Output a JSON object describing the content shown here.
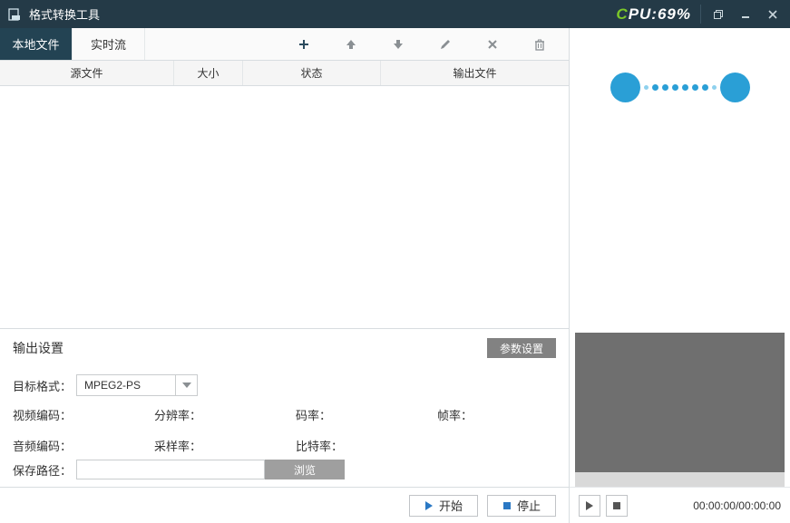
{
  "titlebar": {
    "title": "格式转换工具",
    "cpu_prefix": "C",
    "cpu_rest": "PU:69%"
  },
  "tabs": {
    "local": "本地文件",
    "stream": "实时流"
  },
  "toolbar_icons": {
    "add": "plus-icon",
    "up": "arrow-up-icon",
    "down": "arrow-down-icon",
    "edit": "pencil-icon",
    "remove": "x-icon",
    "clear": "trash-icon"
  },
  "columns": {
    "source": "源文件",
    "size": "大小",
    "state": "状态",
    "output": "输出文件"
  },
  "output": {
    "panel_title": "输出设置",
    "param_btn": "参数设置",
    "target_label": "目标格式：",
    "target_value": "MPEG2-PS",
    "video_codec": "视频编码：",
    "resolution": "分辨率：",
    "bitrate": "码率：",
    "framerate": "帧率：",
    "audio_codec": "音频编码：",
    "samplerate": "采样率：",
    "abitrate": "比特率：",
    "save_path_label": "保存路径：",
    "save_path_value": "",
    "browse": "浏览"
  },
  "footer": {
    "start": "开始",
    "stop": "停止"
  },
  "player": {
    "time": "00:00:00/00:00:00"
  }
}
